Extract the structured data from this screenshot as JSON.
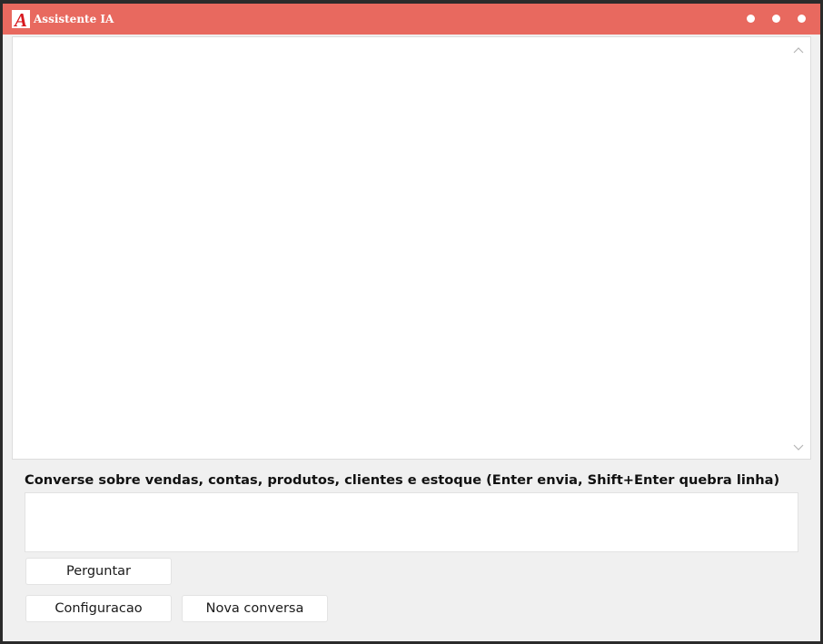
{
  "window": {
    "title": "Assistente IA",
    "logo_letter": "A",
    "accent_color": "#e8695f",
    "controls": [
      "dot",
      "dot",
      "dot"
    ]
  },
  "chat": {
    "messages": [],
    "scroll_up_icon": "chevron-up-icon",
    "scroll_down_icon": "chevron-down-icon"
  },
  "composer": {
    "label": "Converse sobre vendas, contas, produtos, clientes e estoque (Enter envia, Shift+Enter quebra linha)",
    "value": "",
    "ask_button": "Perguntar"
  },
  "footer": {
    "config_button": "Configuracao",
    "new_chat_button": "Nova conversa"
  }
}
